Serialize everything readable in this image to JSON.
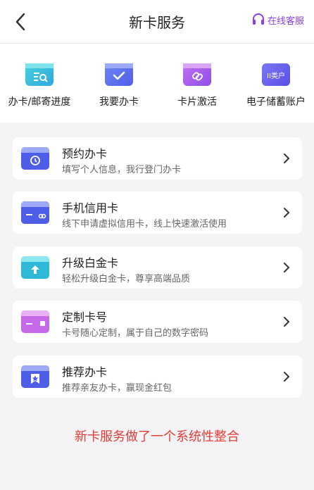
{
  "header": {
    "title": "新卡服务",
    "service_label": "在线客服",
    "accent": "#8b3ee8"
  },
  "quick": [
    {
      "label": "办卡/邮寄进度",
      "icon": "progress-search-icon"
    },
    {
      "label": "我要办卡",
      "icon": "apply-card-icon"
    },
    {
      "label": "卡片激活",
      "icon": "activate-card-icon"
    },
    {
      "label": "电子储蓄账户",
      "icon": "e-savings-account-icon",
      "icon_text": "II类户"
    }
  ],
  "cards": [
    {
      "title": "预约办卡",
      "subtitle": "填写个人信息，我行登门办卡",
      "icon": "appointment-card-icon"
    },
    {
      "title": "手机信用卡",
      "subtitle": "线下申请虚拟信用卡，线上快速激活使用",
      "icon": "mobile-credit-card-icon"
    },
    {
      "title": "升级白金卡",
      "subtitle": "轻松升级白金卡，尊享高端品质",
      "icon": "upgrade-platinum-icon"
    },
    {
      "title": "定制卡号",
      "subtitle": "卡号随心定制，属于自己的数字密码",
      "icon": "custom-card-number-icon"
    },
    {
      "title": "推荐办卡",
      "subtitle": "推荐亲友办卡，赢现金红包",
      "icon": "recommend-card-icon"
    }
  ],
  "promo_text": "新卡服务做了一个系统性整合"
}
